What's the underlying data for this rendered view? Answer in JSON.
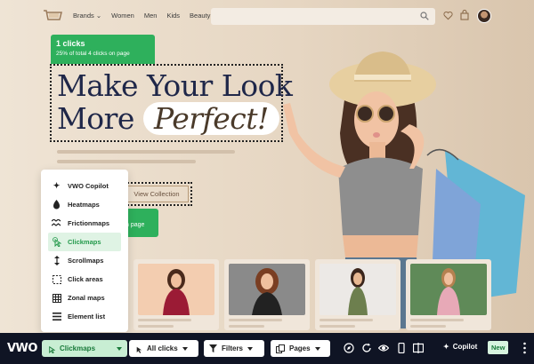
{
  "nav": {
    "items": [
      "Brands",
      "Women",
      "Men",
      "Kids",
      "Beauty"
    ],
    "search_placeholder": ""
  },
  "hero": {
    "tooltip": {
      "clicks": "1 clicks",
      "detail": "25% of total 4 clicks on page"
    },
    "headline_line1": "Make Your Look",
    "headline_line2_prefix": "More",
    "headline_highlight": "Perfect!",
    "cta": "View Collection",
    "partial_tooltip": "n page"
  },
  "dropdown": {
    "items": [
      {
        "label": "VWO Copilot",
        "icon": "sparkle-icon"
      },
      {
        "label": "Heatmaps",
        "icon": "flame-icon"
      },
      {
        "label": "Frictionmaps",
        "icon": "friction-icon"
      },
      {
        "label": "Clickmaps",
        "icon": "click-icon",
        "selected": true
      },
      {
        "label": "Scrollmaps",
        "icon": "scroll-icon"
      },
      {
        "label": "Click areas",
        "icon": "click-area-icon"
      },
      {
        "label": "Zonal maps",
        "icon": "grid-icon"
      },
      {
        "label": "Element list",
        "icon": "list-icon"
      }
    ]
  },
  "toolbar": {
    "brand": "VWO",
    "mode": "Clickmaps",
    "filter_clicks": "All clicks",
    "filters": "Filters",
    "pages": "Pages",
    "copilot": "Copilot",
    "copilot_badge": "New"
  },
  "colors": {
    "accent_green": "#2eb05c",
    "toolbar_bg": "#0f1424",
    "headline": "#1f2749"
  }
}
